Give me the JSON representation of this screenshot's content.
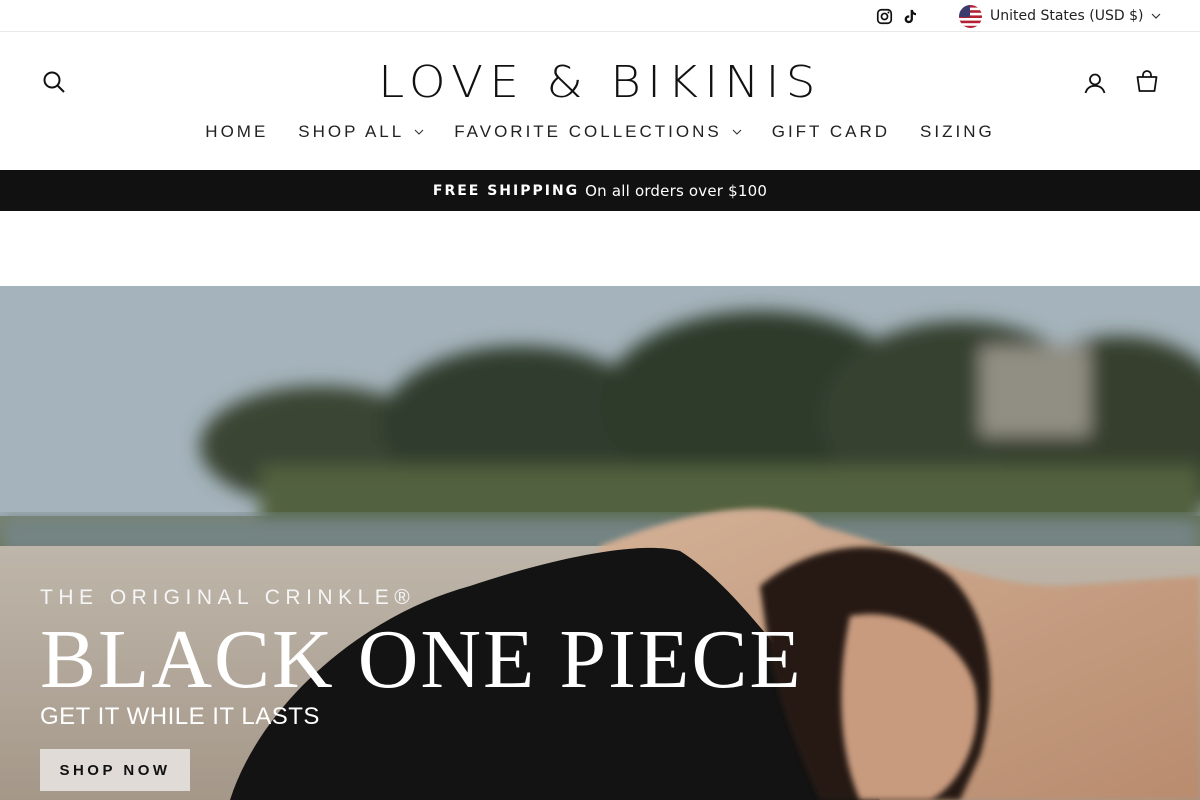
{
  "utility_bar": {
    "social": [
      "instagram-icon",
      "tiktok-icon"
    ],
    "country_selector": "United States (USD $)"
  },
  "header": {
    "logo": "LOVE & BIKINIS",
    "icons": {
      "search": "search-icon",
      "account": "user-icon",
      "cart": "bag-icon"
    },
    "nav": [
      {
        "label": "HOME",
        "has_dropdown": false
      },
      {
        "label": "SHOP ALL",
        "has_dropdown": true
      },
      {
        "label": "FAVORITE COLLECTIONS",
        "has_dropdown": true
      },
      {
        "label": "GIFT CARD",
        "has_dropdown": false
      },
      {
        "label": "SIZING",
        "has_dropdown": false
      }
    ]
  },
  "announcement": {
    "strong": "FREE SHIPPING",
    "text": "On all orders over $100"
  },
  "hero": {
    "eyebrow": "THE ORIGINAL CRINKLE®",
    "title": "BLACK ONE PIECE",
    "subtitle": "GET IT WHILE IT LASTS",
    "cta": "SHOP NOW"
  },
  "colors": {
    "announcement_bg": "#111111",
    "hero_text": "#ffffff",
    "button_bg": "#e6e1de"
  }
}
